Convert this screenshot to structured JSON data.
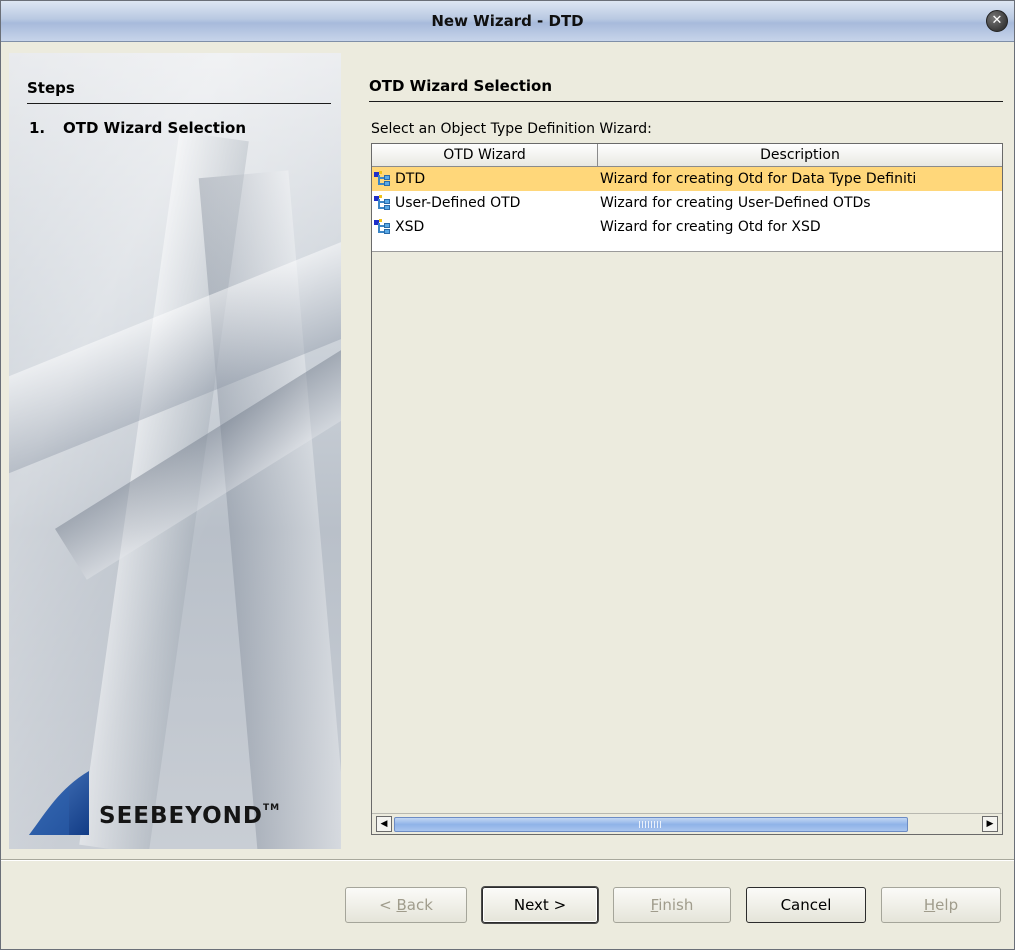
{
  "window": {
    "title": "New Wizard - DTD",
    "close_icon": "close-icon"
  },
  "steps": {
    "heading": "Steps",
    "items": [
      {
        "number": "1.",
        "label": "OTD Wizard Selection"
      }
    ]
  },
  "logo": {
    "text": "SeeBeyond",
    "trademark": "TM"
  },
  "content": {
    "heading": "OTD Wizard Selection",
    "prompt": "Select an Object Type Definition Wizard:",
    "table": {
      "columns": [
        "OTD Wizard",
        "Description"
      ],
      "rows": [
        {
          "name": "DTD",
          "description": "Wizard for creating Otd for Data Type Definiti",
          "selected": true,
          "icon": "otd-tree-icon"
        },
        {
          "name": "User-Defined OTD",
          "description": "Wizard for creating User-Defined OTDs",
          "selected": false,
          "icon": "otd-tree-icon"
        },
        {
          "name": "XSD",
          "description": "Wizard for creating Otd for XSD",
          "selected": false,
          "icon": "otd-tree-icon"
        }
      ]
    },
    "scrollbar": {
      "left_icon": "scroll-left-arrow-icon",
      "right_icon": "scroll-right-arrow-icon"
    }
  },
  "buttons": {
    "back": {
      "label": "< Back",
      "mnemonic": "B",
      "enabled": false
    },
    "next": {
      "label": "Next >",
      "enabled": true
    },
    "finish": {
      "label": "Finish",
      "mnemonic": "F",
      "enabled": false
    },
    "cancel": {
      "label": "Cancel",
      "enabled": true
    },
    "help": {
      "label": "Help",
      "mnemonic": "H",
      "enabled": false
    }
  },
  "colors": {
    "selection": "#ffd77a",
    "dialog_background": "#ecebde",
    "scroll_thumb": "#8fb3e8"
  }
}
